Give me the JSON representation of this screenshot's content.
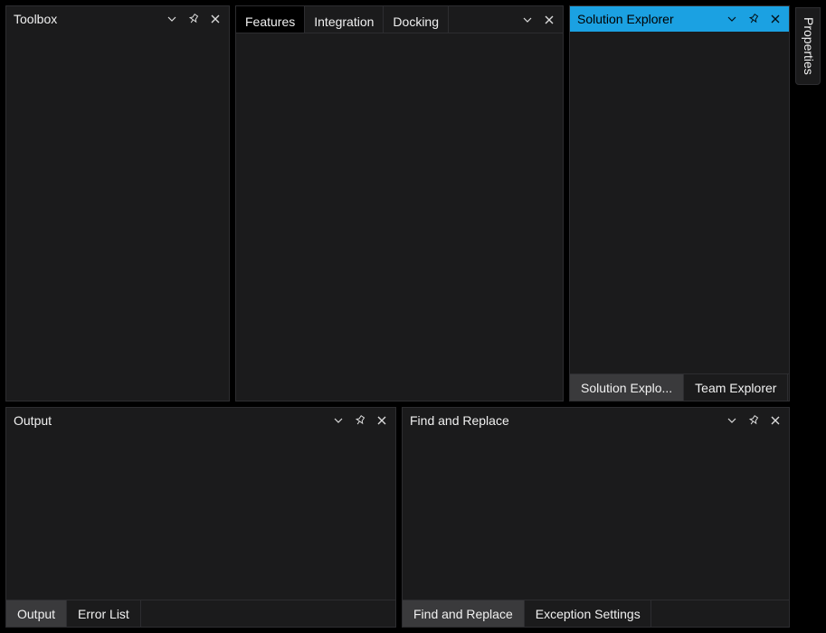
{
  "toolbox": {
    "title": "Toolbox"
  },
  "docs": {
    "tabs": [
      {
        "label": "Features",
        "active": true
      },
      {
        "label": "Integration",
        "active": false
      },
      {
        "label": "Docking",
        "active": false
      }
    ]
  },
  "solution": {
    "title": "Solution Explorer",
    "bottom_tabs": [
      {
        "label": "Solution Explo...",
        "active": true
      },
      {
        "label": "Team Explorer",
        "active": false
      }
    ]
  },
  "output": {
    "title": "Output",
    "bottom_tabs": [
      {
        "label": "Output",
        "active": true
      },
      {
        "label": "Error List",
        "active": false
      }
    ]
  },
  "find": {
    "title": "Find and Replace",
    "bottom_tabs": [
      {
        "label": "Find and Replace",
        "active": true
      },
      {
        "label": "Exception Settings",
        "active": false
      }
    ]
  },
  "autohide": {
    "properties": "Properties"
  }
}
